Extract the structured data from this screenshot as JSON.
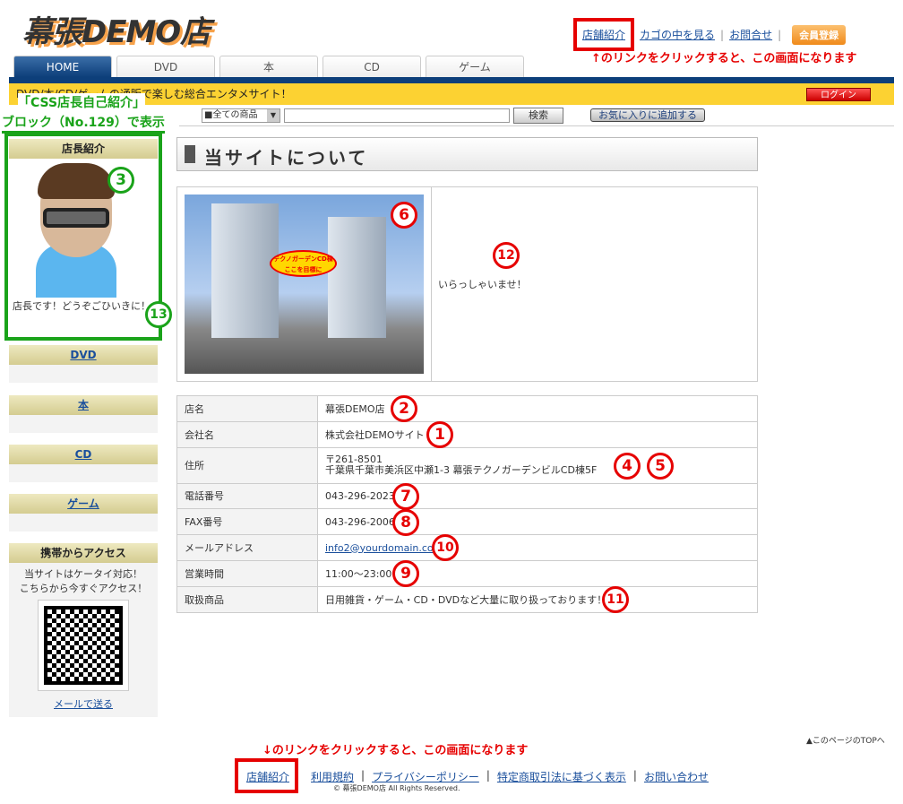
{
  "header": {
    "logo": "幕張DEMO店",
    "links": [
      "店舗紹介",
      "カゴの中を見る",
      "お問合せ"
    ],
    "member_button": "会員登録",
    "note": "↑のリンクをクリックすると、この画面になります"
  },
  "tabs": [
    {
      "label": "HOME",
      "active": true
    },
    {
      "label": "DVD"
    },
    {
      "label": "本"
    },
    {
      "label": "CD"
    },
    {
      "label": "ゲーム"
    }
  ],
  "banner": {
    "text": "DVD/本/CD/ゲームの通販で楽しむ総合エンタメサイト！",
    "login": "ログイン"
  },
  "search": {
    "category": "■全ての商品",
    "value": "",
    "button": "検索",
    "favorite": "お気に入りに追加する"
  },
  "annotation_green": {
    "line1": "「CSS店長自己紹介」",
    "line2": "ブロック（No.129）で表示"
  },
  "sidebar": {
    "manager_title": "店長紹介",
    "manager_text": "店長です！どうぞごひいきに！",
    "categories": [
      "DVD",
      "本",
      "CD",
      "ゲーム"
    ],
    "mobile_title": "携帯からアクセス",
    "mobile_text1": "当サイトはケータイ対応！",
    "mobile_text2": "こちらから今すぐアクセス！",
    "mail_link": "メールで送る"
  },
  "main": {
    "title": "当サイトについて",
    "photo_sign": "テクノガーデンCD棟 ここを目標に",
    "welcome": "いらっしゃいませ！",
    "info": [
      {
        "k": "店名",
        "v": "幕張DEMO店"
      },
      {
        "k": "会社名",
        "v": "株式会社DEMOサイト"
      },
      {
        "k": "住所",
        "v": "〒261-8501",
        "v2": "千葉県千葉市美浜区中瀬1-3 幕張テクノガーデンビルCD棟5F"
      },
      {
        "k": "電話番号",
        "v": "043-296-2023"
      },
      {
        "k": "FAX番号",
        "v": "043-296-2006"
      },
      {
        "k": "メールアドレス",
        "v": "info2@yourdomain.com"
      },
      {
        "k": "営業時間",
        "v": "11:00〜23:00"
      },
      {
        "k": "取扱商品",
        "v": "日用雑貨・ゲーム・CD・DVDなど大量に取り扱っております！"
      }
    ]
  },
  "markers": [
    "1",
    "2",
    "3",
    "4",
    "5",
    "6",
    "7",
    "8",
    "9",
    "10",
    "11",
    "12",
    "13"
  ],
  "footer": {
    "pagetop": "▲このページのTOPへ",
    "note": "↓のリンクをクリックすると、この画面になります",
    "links": [
      "店舗紹介",
      "利用規約",
      "プライバシーポリシー",
      "特定商取引法に基づく表示",
      "お問い合わせ"
    ],
    "copyright": "© 幕張DEMO店 All Rights Reserved."
  },
  "colors": {
    "navy": "#0d3f7a",
    "yellow": "#fcd232",
    "annotation_red": "#e60000",
    "annotation_green": "#1aa31a"
  }
}
